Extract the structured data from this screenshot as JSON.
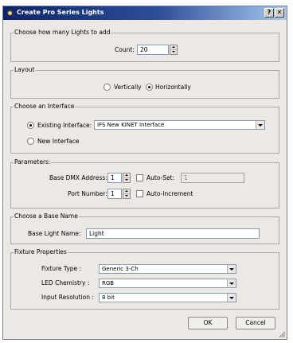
{
  "window": {
    "title": "Create Pro Series Lights",
    "help_label": "?",
    "close_label": "✕"
  },
  "lights_count": {
    "legend": "Choose how many Lights to add",
    "count_label": "Count:",
    "count_value": "20"
  },
  "layout": {
    "legend": "Layout",
    "vertically_label": "Vertically",
    "horizontally_label": "Horizontally",
    "selected": "horizontally"
  },
  "interface": {
    "legend": "Choose an Interface",
    "existing_label": "Existing Interface:",
    "existing_value": "IFS New KINET Interface",
    "new_label": "New Interface",
    "selected": "existing"
  },
  "parameters": {
    "legend": "Parameters:",
    "dmx_label": "Base DMX Address:",
    "dmx_value": "1",
    "autoset_label": "Auto-Set:",
    "autoset_value": "1",
    "autoset_checked": false,
    "port_label": "Port Number:",
    "port_value": "1",
    "autoincrement_label": "Auto-Increment",
    "autoincrement_checked": false
  },
  "base_name": {
    "legend": "Choose a Base Name",
    "label": "Base Light Name:",
    "value": "Light"
  },
  "fixture": {
    "legend": "Fixture Properties",
    "type_label": "Fixture Type :",
    "type_value": "Generic 3-Ch",
    "chemistry_label": "LED Chemistry :",
    "chemistry_value": "RGB",
    "resolution_label": "Input Resolution :",
    "resolution_value": "8 bit"
  },
  "buttons": {
    "ok_label": "OK",
    "cancel_label": "Cancel"
  },
  "colors": {
    "title_gradient_start": "#0a246a",
    "title_gradient_end": "#a6caf0",
    "dialog_background": "#ece9e4"
  }
}
